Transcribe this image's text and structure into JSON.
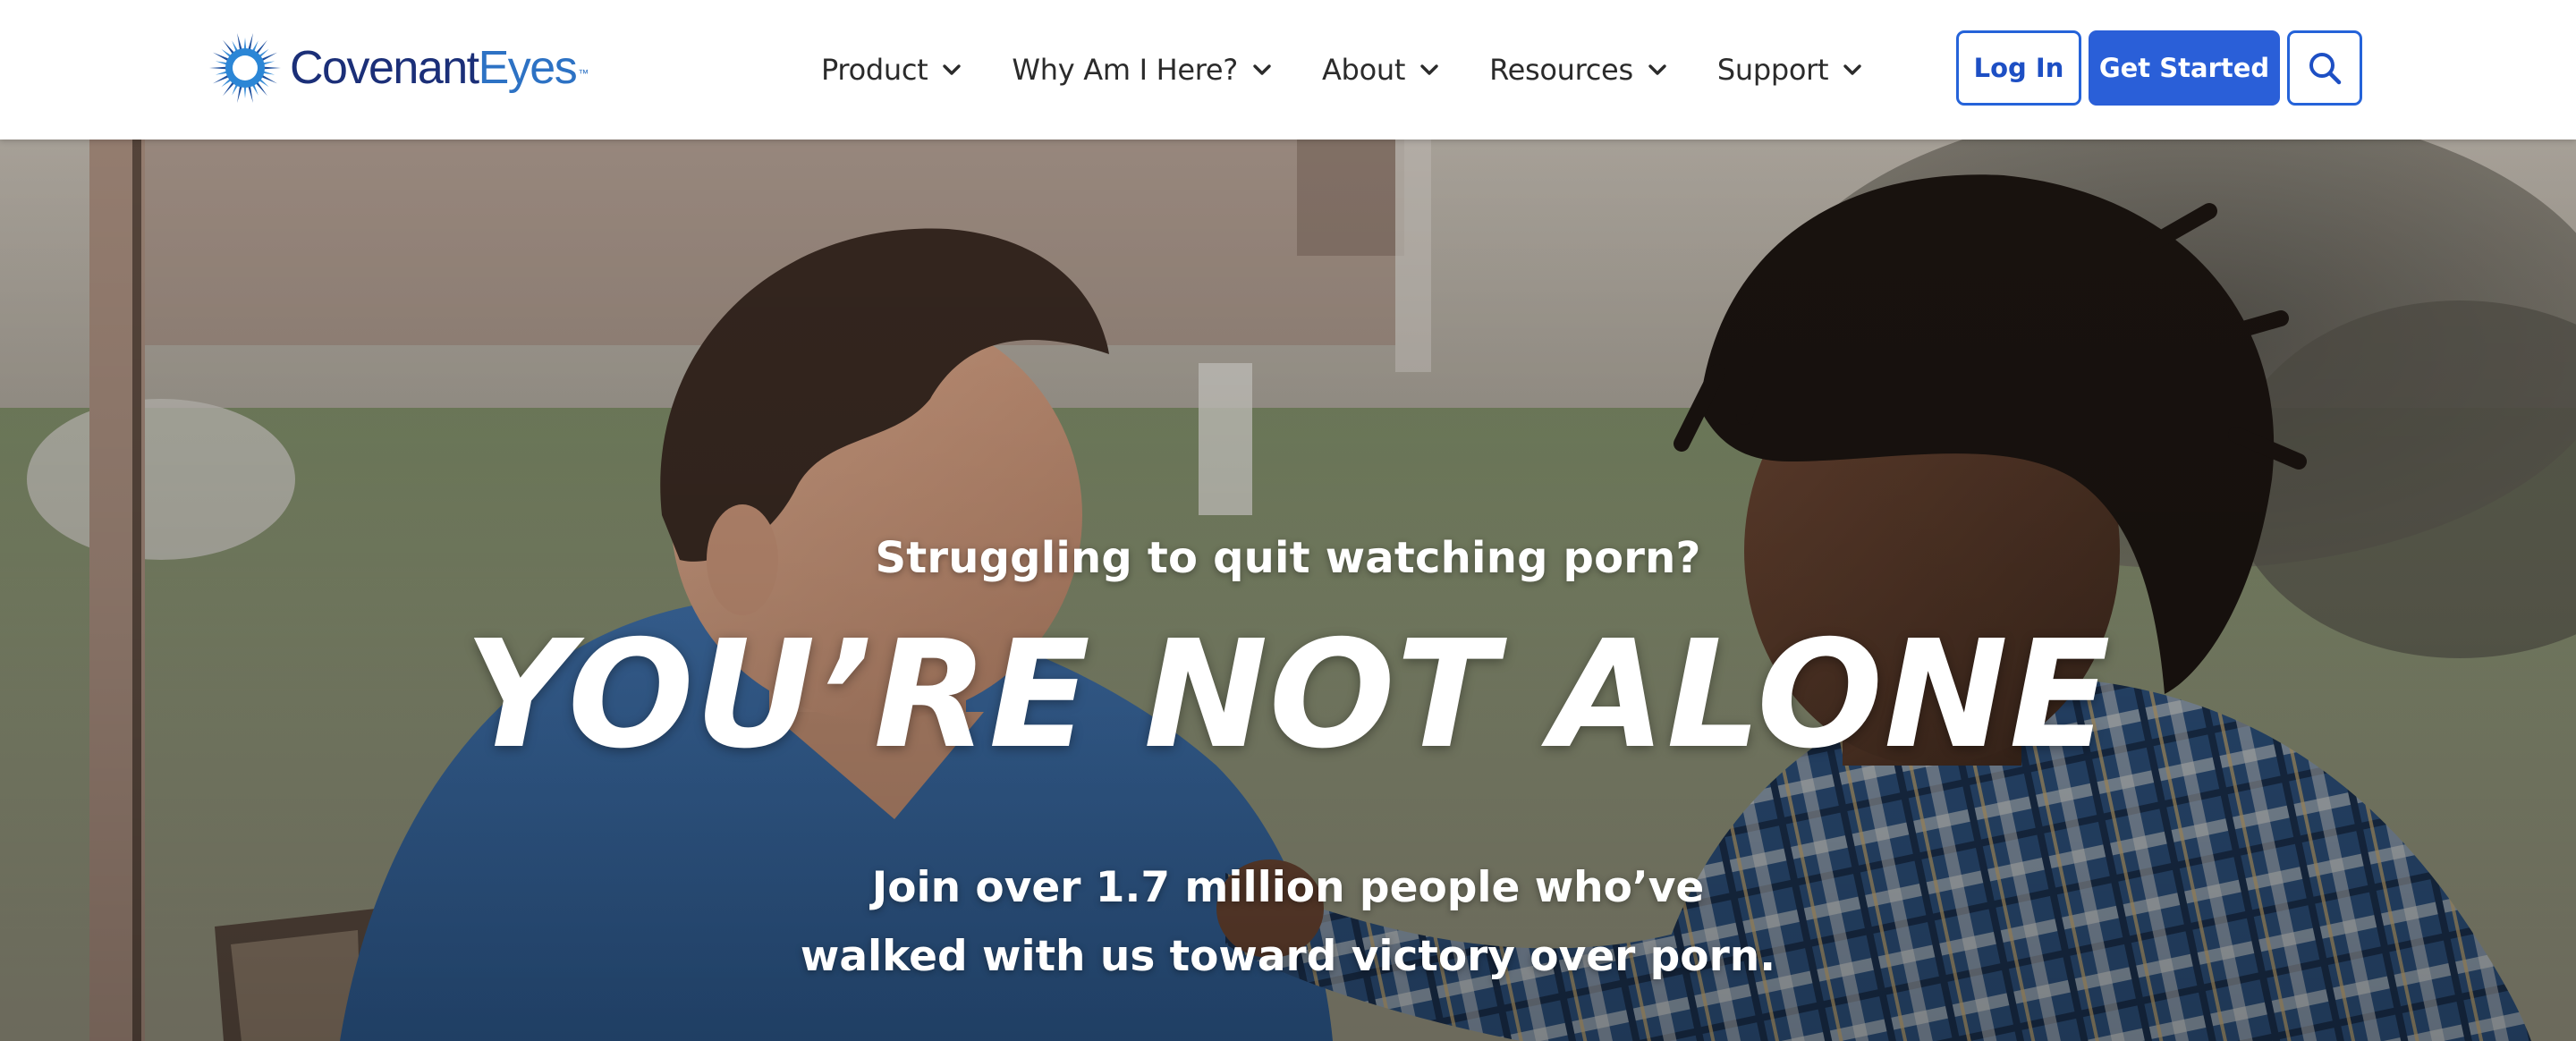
{
  "brand": {
    "name_part1": "Covenant",
    "name_part2": "Eyes",
    "trademark": "™",
    "logo_icon": "sunburst-eye-icon",
    "colors": {
      "navy": "#1b2f78",
      "blue": "#2d72c4"
    }
  },
  "nav": {
    "items": [
      {
        "label": "Product",
        "icon": "chevron-down-icon"
      },
      {
        "label": "Why Am I Here?",
        "icon": "chevron-down-icon"
      },
      {
        "label": "About",
        "icon": "chevron-down-icon"
      },
      {
        "label": "Resources",
        "icon": "chevron-down-icon"
      },
      {
        "label": "Support",
        "icon": "chevron-down-icon"
      }
    ]
  },
  "actions": {
    "login_label": "Log In",
    "get_started_label": "Get Started",
    "search_icon": "search-icon",
    "accent_color": "#2a5fd8"
  },
  "hero": {
    "eyebrow": "Struggling to quit watching porn?",
    "title": "YOU’RE NOT ALONE",
    "subtitle_line1": "Join over 1.7 million people who’ve",
    "subtitle_line2": "walked with us toward victory over porn.",
    "background_image": "two-men-talking-outdoors-photo"
  }
}
